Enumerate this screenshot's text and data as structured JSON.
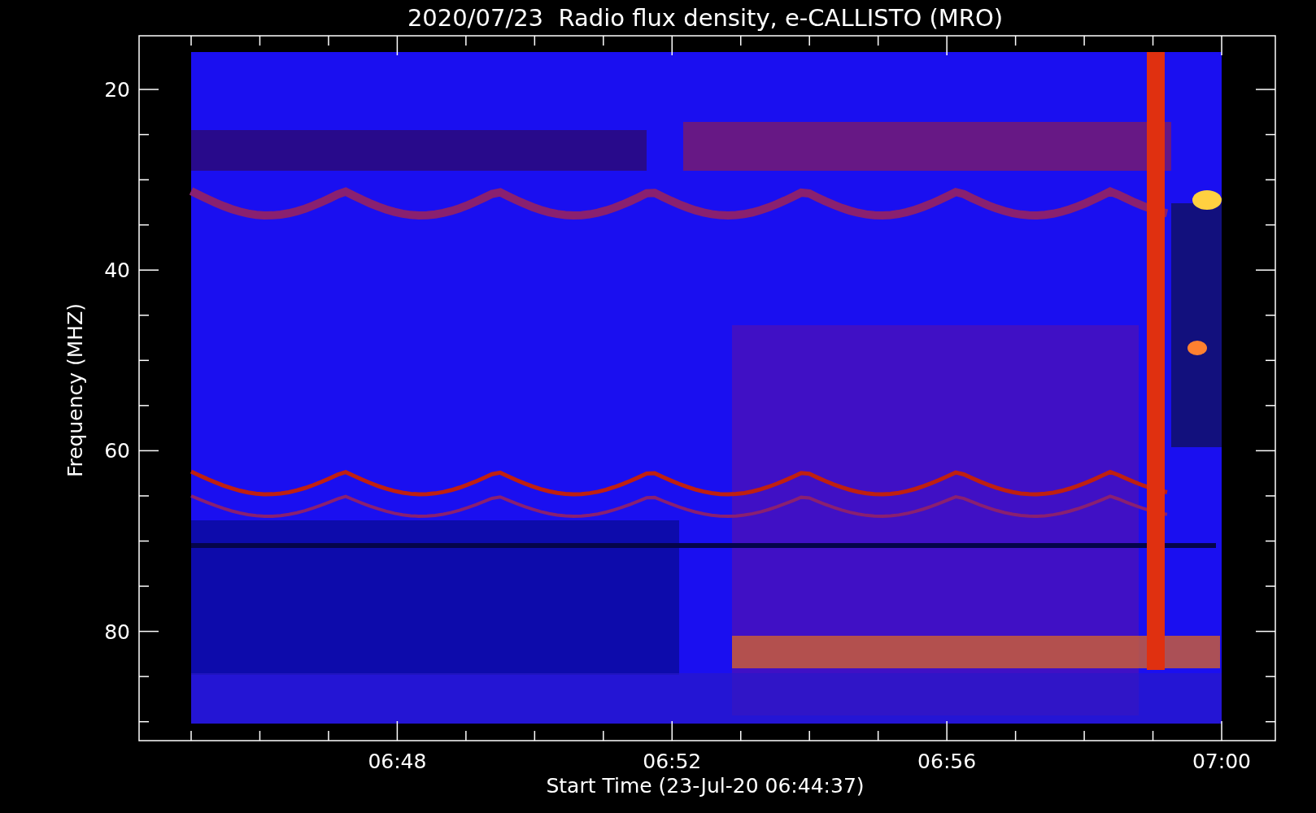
{
  "title": "2020/07/23  Radio flux density, e-CALLISTO (MRO)",
  "plot": {
    "ylabel": "Frequency (MHZ)",
    "xlabel": "Start Time (23-Jul-20 06:44:37)",
    "yticks": [
      "20",
      "40",
      "60",
      "80"
    ],
    "xticks": [
      "06:48",
      "06:52",
      "06:56",
      "07:00"
    ]
  }
}
